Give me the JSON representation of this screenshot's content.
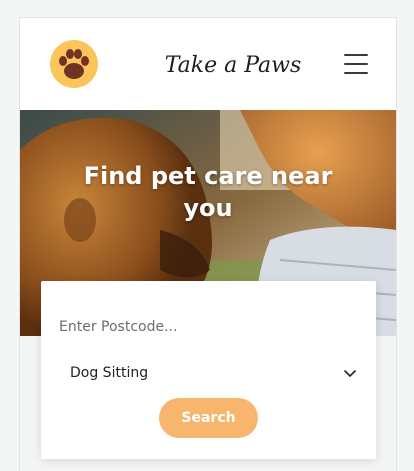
{
  "header": {
    "brand_name": "Take a Paws",
    "logo_icon": "paw-icon",
    "menu_icon": "hamburger-menu-icon"
  },
  "hero": {
    "title": "Find pet care near you"
  },
  "search": {
    "postcode_placeholder": "Enter Postcode...",
    "postcode_value": "",
    "service_selected": "Dog Sitting",
    "button_label": "Search"
  },
  "colors": {
    "accent": "#f7b56d",
    "logo_circle": "#fcc55a",
    "paw": "#6e3325"
  }
}
